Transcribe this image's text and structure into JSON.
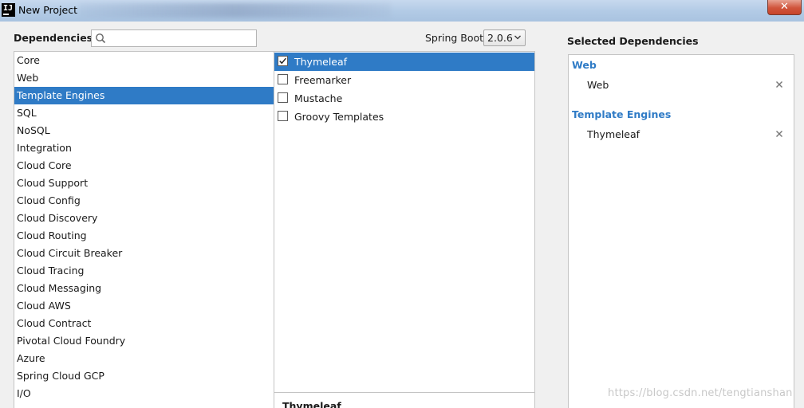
{
  "window": {
    "title": "New Project",
    "app_icon_text": "IJ",
    "close_glyph": "✕"
  },
  "header": {
    "dependencies_label": "Dependencies",
    "search": {
      "value": "",
      "placeholder": ""
    },
    "spring_boot_label": "Spring Boot",
    "spring_boot_version": "2.0.6",
    "selected_label": "Selected Dependencies"
  },
  "categories": [
    {
      "label": "Core"
    },
    {
      "label": "Web"
    },
    {
      "label": "Template Engines",
      "selected": true
    },
    {
      "label": "SQL"
    },
    {
      "label": "NoSQL"
    },
    {
      "label": "Integration"
    },
    {
      "label": "Cloud Core"
    },
    {
      "label": "Cloud Support"
    },
    {
      "label": "Cloud Config"
    },
    {
      "label": "Cloud Discovery"
    },
    {
      "label": "Cloud Routing"
    },
    {
      "label": "Cloud Circuit Breaker"
    },
    {
      "label": "Cloud Tracing"
    },
    {
      "label": "Cloud Messaging"
    },
    {
      "label": "Cloud AWS"
    },
    {
      "label": "Cloud Contract"
    },
    {
      "label": "Pivotal Cloud Foundry"
    },
    {
      "label": "Azure"
    },
    {
      "label": "Spring Cloud GCP"
    },
    {
      "label": "I/O"
    }
  ],
  "dependencies": [
    {
      "label": "Thymeleaf",
      "checked": true,
      "selected": true
    },
    {
      "label": "Freemarker",
      "checked": false
    },
    {
      "label": "Mustache",
      "checked": false
    },
    {
      "label": "Groovy Templates",
      "checked": false
    }
  ],
  "description": {
    "title": "Thymeleaf"
  },
  "selected_dependencies": [
    {
      "group": "Web",
      "items": [
        "Web"
      ]
    },
    {
      "group": "Template Engines",
      "items": [
        "Thymeleaf"
      ]
    }
  ],
  "remove_glyph": "×",
  "watermark": "https://blog.csdn.net/tengtianshan",
  "colors": {
    "selection": "#2f7bc6",
    "group_header": "#2f7bc6",
    "close_button": "#c7442a"
  }
}
